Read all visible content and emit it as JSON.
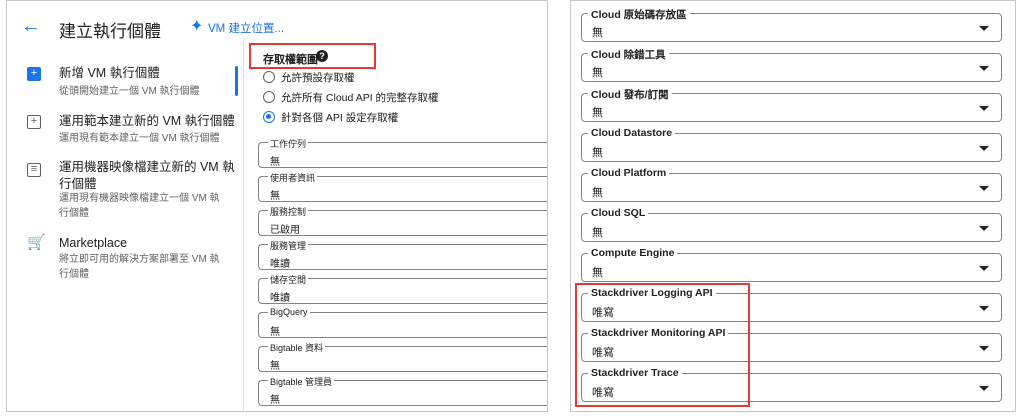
{
  "header": {
    "back_icon": "arrow-left-icon",
    "title": "建立執行個體",
    "vm_link": "VM 建立位置..."
  },
  "nav": {
    "items": [
      {
        "title": "新增 VM 執行個體",
        "subtitle": "從頭開始建立一個 VM 執行個體",
        "icon": "add-box-icon"
      },
      {
        "title": "運用範本建立新的 VM 執行個體",
        "subtitle": "運用現有範本建立一個 VM 執行個體",
        "icon": "template-icon"
      },
      {
        "title": "運用機器映像檔建立新的 VM 執行個體",
        "subtitle": "運用現有機器映像檔建立一個 VM 執行個體",
        "icon": "machine-image-icon"
      },
      {
        "title": "Marketplace",
        "subtitle": "將立即可用的解決方案部署至 VM 執行個體",
        "icon": "cart-icon"
      }
    ]
  },
  "access_scope": {
    "label": "存取權範圍",
    "options": [
      {
        "label": "允許預設存取權",
        "checked": false
      },
      {
        "label": "允許所有 Cloud API 的完整存取權",
        "checked": false
      },
      {
        "label": "針對各個 API 設定存取權",
        "checked": true
      }
    ]
  },
  "left_fields": [
    {
      "label": "工作佇列",
      "value": "無"
    },
    {
      "label": "使用者資訊",
      "value": "無"
    },
    {
      "label": "服務控制",
      "value": "已啟用"
    },
    {
      "label": "服務管理",
      "value": "唯讀"
    },
    {
      "label": "儲存空間",
      "value": "唯讀"
    },
    {
      "label": "BigQuery",
      "value": "無"
    },
    {
      "label": "Bigtable 資料",
      "value": "無"
    },
    {
      "label": "Bigtable 管理員",
      "value": "無"
    }
  ],
  "right_fields": [
    {
      "label": "Cloud 原始碼存放區",
      "value": "無"
    },
    {
      "label": "Cloud 除錯工具",
      "value": "無"
    },
    {
      "label": "Cloud 發布/訂閱",
      "value": "無"
    },
    {
      "label": "Cloud Datastore",
      "value": "無"
    },
    {
      "label": "Cloud Platform",
      "value": "無"
    },
    {
      "label": "Cloud SQL",
      "value": "無"
    },
    {
      "label": "Compute Engine",
      "value": "無"
    },
    {
      "label": "Stackdriver Logging API",
      "value": "唯寫"
    },
    {
      "label": "Stackdriver Monitoring API",
      "value": "唯寫"
    },
    {
      "label": "Stackdriver Trace",
      "value": "唯寫"
    }
  ],
  "colors": {
    "accent": "#1a73e8",
    "highlight": "#e53935"
  }
}
